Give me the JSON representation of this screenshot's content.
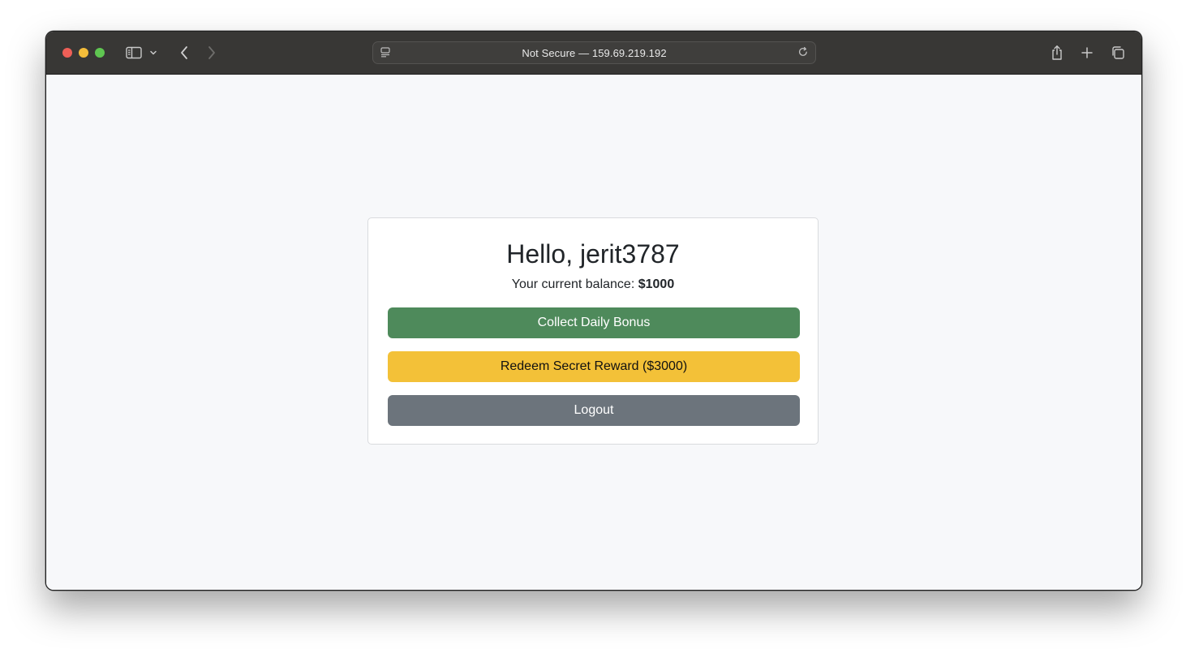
{
  "browser": {
    "address": "Not Secure — 159.69.219.192"
  },
  "page": {
    "greeting": "Hello, jerit3787",
    "balance_label": "Your current balance: ",
    "balance_value": "$1000",
    "buttons": {
      "collect": "Collect Daily Bonus",
      "redeem": "Redeem Secret Reward ($3000)",
      "logout": "Logout"
    }
  },
  "colors": {
    "collect_button": "#4e8a5b",
    "redeem_button": "#f3c138",
    "logout_button": "#6c747c"
  },
  "icons": {
    "toolbar": [
      "sidebar-icon",
      "chevron-down-icon",
      "back-icon",
      "forward-icon",
      "share-icon",
      "new-tab-icon",
      "tabs-overview-icon"
    ],
    "address_bar": [
      "site-settings-icon",
      "reload-icon"
    ]
  }
}
